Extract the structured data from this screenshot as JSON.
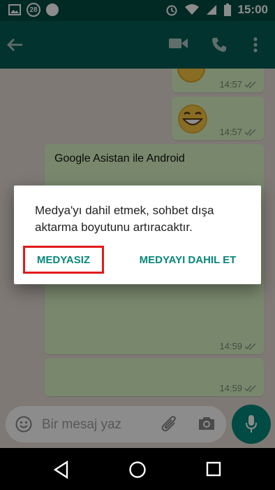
{
  "status_bar": {
    "time": "15:00",
    "badge": "28"
  },
  "chat": {
    "messages": [
      {
        "type": "emoji",
        "time": "14:57"
      },
      {
        "type": "emoji",
        "time": "14:57"
      },
      {
        "type": "text",
        "title": "Google Asistan ile Android",
        "time": "14:59"
      },
      {
        "type": "text",
        "title": "",
        "time": "14:59"
      }
    ]
  },
  "input": {
    "placeholder": "Bir mesaj yaz"
  },
  "dialog": {
    "message": "Medya'yı dahil etmek, sohbet dışa aktarma boyutunu artıracaktır.",
    "button_without_media": "MEDYASIZ",
    "button_with_media": "MEDYAYI DAHIL ET"
  },
  "colors": {
    "header": "#075e54",
    "status_bar": "#054d44",
    "bubble": "#dcf8c6",
    "accent": "#07877a",
    "highlight": "#e01b1b"
  }
}
